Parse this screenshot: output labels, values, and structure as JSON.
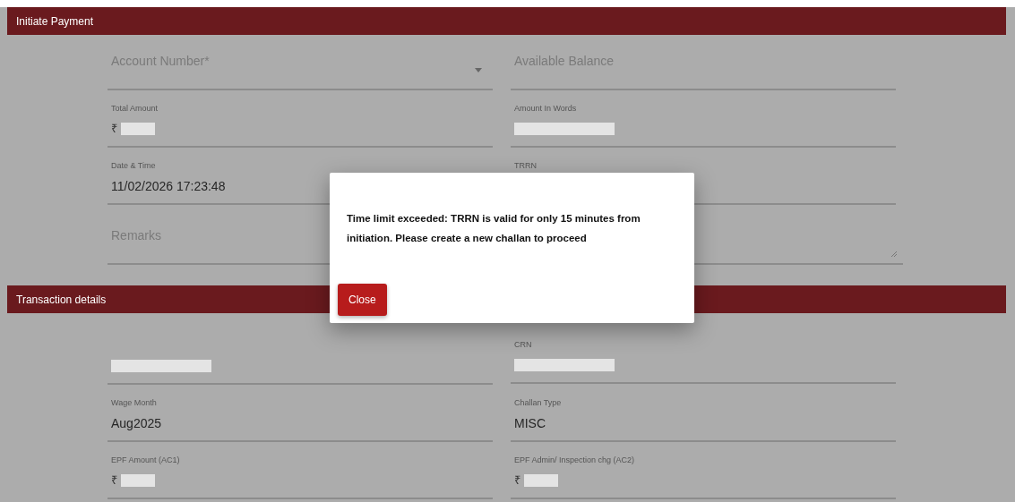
{
  "sections": [
    {
      "title": "Initiate Payment",
      "rows": [
        [
          {
            "kind": "select",
            "placeholder": "Account Number*"
          },
          {
            "kind": "input",
            "placeholder": "Available Balance"
          }
        ],
        [
          {
            "kind": "input",
            "label": "Total Amount",
            "prefix": "₹",
            "redacted": true
          },
          {
            "kind": "input",
            "label": "Amount In Words",
            "redacted": true
          }
        ],
        [
          {
            "kind": "input",
            "label": "Date & Time",
            "value": "11/02/2026 17:23:48"
          },
          {
            "kind": "input",
            "label": "TRRN"
          }
        ],
        [
          {
            "kind": "textarea",
            "placeholder": "Remarks"
          },
          {
            "kind": "textarea"
          }
        ]
      ]
    },
    {
      "title": "Transaction details",
      "rows": [
        [
          {
            "kind": "input",
            "redacted": true
          },
          {
            "kind": "input",
            "label": "CRN",
            "redacted": true
          }
        ],
        [
          {
            "kind": "input",
            "label": "Wage Month",
            "value": "Aug2025"
          },
          {
            "kind": "input",
            "label": "Challan Type",
            "value": "MISC"
          }
        ],
        [
          {
            "kind": "input",
            "label": "EPF Amount (AC1)",
            "prefix": "₹",
            "redacted": true
          },
          {
            "kind": "input",
            "label": "EPF Admin/ Inspection chg (AC2)",
            "prefix": "₹",
            "redacted": true
          }
        ]
      ]
    }
  ],
  "dialog": {
    "message": "Time limit exceeded: TRRN is valid for only 15 minutes from initiation. Please create a new challan to proceed",
    "button": "Close"
  }
}
